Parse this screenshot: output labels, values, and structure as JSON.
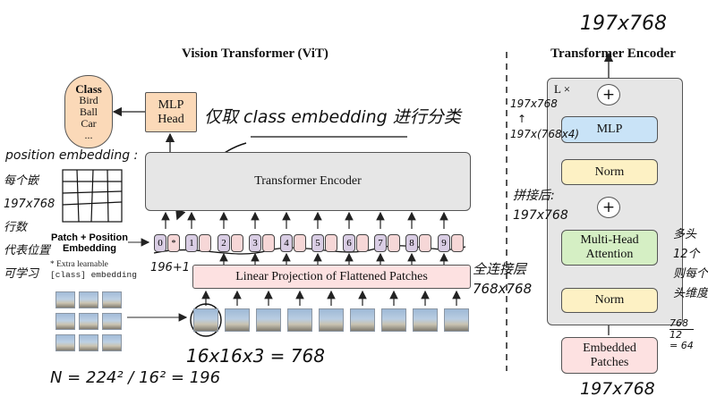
{
  "vit": {
    "title": "Vision Transformer (ViT)",
    "class_box": {
      "title": "Class",
      "items": [
        "Bird",
        "Ball",
        "Car",
        "..."
      ]
    },
    "mlp_head": [
      "MLP",
      "Head"
    ],
    "transformer_encoder": "Transformer Encoder",
    "linear_projection": "Linear Projection of Flattened Patches",
    "patch_position_embedding": [
      "Patch + Position",
      "Embedding"
    ],
    "extra_note": [
      "* Extra learnable",
      "[class] embedding"
    ],
    "tokens": [
      "0",
      "1",
      "2",
      "3",
      "4",
      "5",
      "6",
      "7",
      "8",
      "9"
    ],
    "star": "*"
  },
  "encoder": {
    "title": "Transformer Encoder",
    "lx": "L ×",
    "mlp": "MLP",
    "norm_top": "Norm",
    "plus": "+",
    "mha": [
      "Multi-Head",
      "Attention"
    ],
    "norm_bottom": "Norm",
    "embedded_patches": [
      "Embedded",
      "Patches"
    ]
  },
  "handwriting": {
    "top_dim": "197x768",
    "bottom_dim": "197x768",
    "class_note": "仅取 class embedding 进行分类",
    "pos_emb_label": "position embedding :",
    "pos_emb_lines": [
      "每个嵌",
      "197x768",
      "行数",
      "代表位置",
      "可学习"
    ],
    "n_calc": "N = 224² / 16² = 196",
    "plus_one": "196+1",
    "patch_calc": "16x16x3 = 768",
    "fc_note": [
      "全连接层",
      "768x768"
    ],
    "mlp_dims": [
      "197x768",
      "↑",
      "197x(768x4)"
    ],
    "concat_note": [
      "拼接后:",
      "197x768"
    ],
    "multi_head_note": [
      "多头",
      "12个",
      "则每个",
      "头维度"
    ],
    "head_dim": [
      "768",
      "12",
      "= 64"
    ]
  }
}
